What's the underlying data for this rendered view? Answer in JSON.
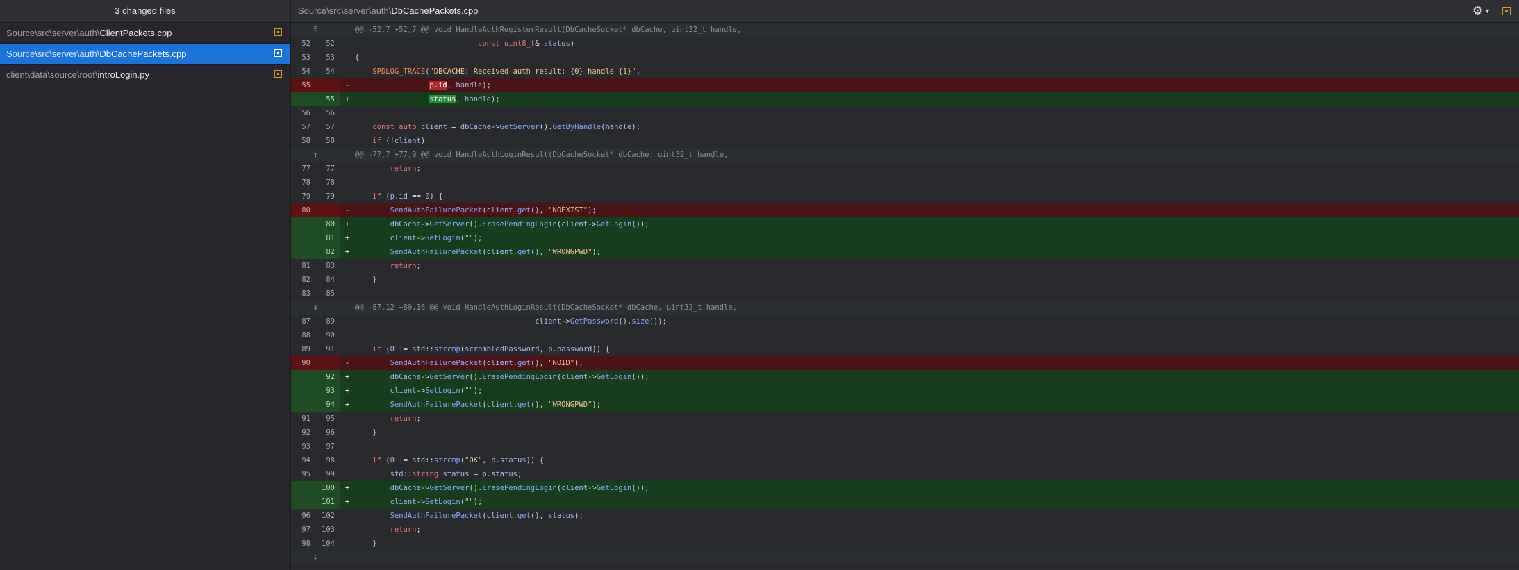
{
  "sidebar": {
    "header": "3 changed files",
    "files": [
      {
        "path": "Source\\src\\server\\auth\\",
        "name": "ClientPackets.cpp",
        "selected": false
      },
      {
        "path": "Source\\src\\server\\auth\\",
        "name": "DbCachePackets.cpp",
        "selected": true
      },
      {
        "path": "client\\data\\source\\root\\",
        "name": "introLogin.py",
        "selected": false
      }
    ]
  },
  "topbar": {
    "path": "Source\\src\\server\\auth\\",
    "filename": "DbCachePackets.cpp",
    "settings_icon": "gear-icon",
    "view_icon": "view-toggle-icon"
  },
  "colors": {
    "accent": "#1a73d8",
    "modified_badge": "#d69a28",
    "deleted_line": "#4a1416",
    "added_line": "#173d1c"
  },
  "diff": {
    "hunk1": {
      "header": "@@ -52,7 +52,7 @@ void HandleAuthRegisterResult(DbCacheSocket* dbCache, uint32_t handle,"
    },
    "hunk2": {
      "header": "@@ -77,7 +77,9 @@ void HandleAuthLoginResult(DbCacheSocket* dbCache, uint32_t handle,"
    },
    "hunk3": {
      "header": "@@ -87,12 +89,16 @@ void HandleAuthLoginResult(DbCacheSocket* dbCache, uint32_t handle,"
    },
    "lines": [
      {
        "old": "52",
        "new": "52",
        "sign": ""
      },
      {
        "old": "53",
        "new": "53",
        "sign": ""
      },
      {
        "old": "54",
        "new": "54",
        "sign": ""
      },
      {
        "old": "55",
        "new": "",
        "sign": "-"
      },
      {
        "old": "",
        "new": "55",
        "sign": "+"
      },
      {
        "old": "56",
        "new": "56",
        "sign": ""
      },
      {
        "old": "57",
        "new": "57",
        "sign": ""
      },
      {
        "old": "58",
        "new": "58",
        "sign": ""
      },
      {
        "old": "77",
        "new": "77",
        "sign": ""
      },
      {
        "old": "78",
        "new": "78",
        "sign": ""
      },
      {
        "old": "79",
        "new": "79",
        "sign": ""
      },
      {
        "old": "80",
        "new": "",
        "sign": "-"
      },
      {
        "old": "",
        "new": "80",
        "sign": "+"
      },
      {
        "old": "",
        "new": "81",
        "sign": "+"
      },
      {
        "old": "",
        "new": "82",
        "sign": "+"
      },
      {
        "old": "81",
        "new": "83",
        "sign": ""
      },
      {
        "old": "82",
        "new": "84",
        "sign": ""
      },
      {
        "old": "83",
        "new": "85",
        "sign": ""
      },
      {
        "old": "87",
        "new": "89",
        "sign": ""
      },
      {
        "old": "88",
        "new": "90",
        "sign": ""
      },
      {
        "old": "89",
        "new": "91",
        "sign": ""
      },
      {
        "old": "90",
        "new": "",
        "sign": "-"
      },
      {
        "old": "",
        "new": "92",
        "sign": "+"
      },
      {
        "old": "",
        "new": "93",
        "sign": "+"
      },
      {
        "old": "",
        "new": "94",
        "sign": "+"
      },
      {
        "old": "91",
        "new": "95",
        "sign": ""
      },
      {
        "old": "92",
        "new": "96",
        "sign": ""
      },
      {
        "old": "93",
        "new": "97",
        "sign": ""
      },
      {
        "old": "94",
        "new": "98",
        "sign": ""
      },
      {
        "old": "95",
        "new": "99",
        "sign": ""
      },
      {
        "old": "",
        "new": "100",
        "sign": "+"
      },
      {
        "old": "",
        "new": "101",
        "sign": "+"
      },
      {
        "old": "96",
        "new": "102",
        "sign": ""
      },
      {
        "old": "97",
        "new": "103",
        "sign": ""
      },
      {
        "old": "98",
        "new": "104",
        "sign": ""
      }
    ]
  }
}
